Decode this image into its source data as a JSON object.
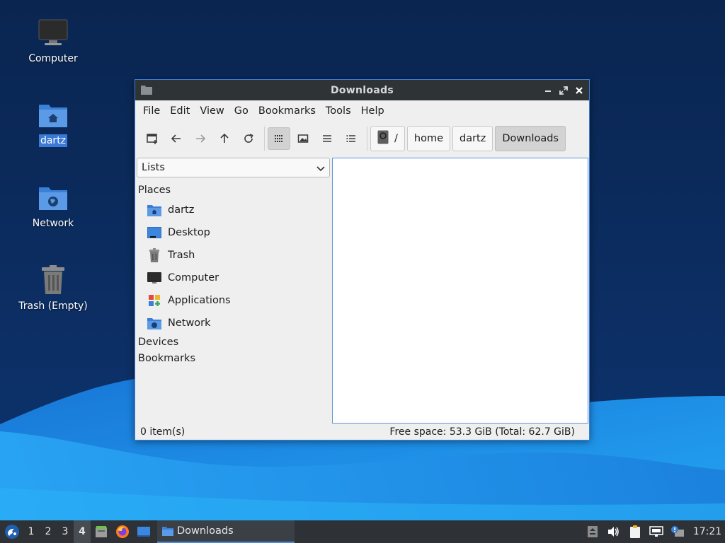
{
  "desktop": {
    "icons": [
      {
        "label": "Computer",
        "icon": "computer-icon"
      },
      {
        "label": "dartz",
        "icon": "home-folder-icon",
        "selected": true
      },
      {
        "label": "Network",
        "icon": "network-folder-icon"
      },
      {
        "label": "Trash (Empty)",
        "icon": "trash-icon"
      }
    ]
  },
  "window": {
    "title": "Downloads",
    "controls": {
      "minimize": "minimize-icon",
      "maximize": "maximize-icon",
      "close": "close-icon"
    },
    "menu": [
      "File",
      "Edit",
      "View",
      "Go",
      "Bookmarks",
      "Tools",
      "Help"
    ],
    "toolbar": {
      "buttons": [
        "new-tab-icon",
        "back-arrow-icon",
        "forward-arrow-icon",
        "up-arrow-icon",
        "reload-icon",
        "icon-view-icon",
        "thumbnail-view-icon",
        "compact-view-icon",
        "detailed-list-view-icon"
      ],
      "active_view": "icon-view-icon"
    },
    "breadcrumbs": [
      "/",
      "home",
      "dartz",
      "Downloads"
    ],
    "sidebar": {
      "mode": "Lists",
      "sections": {
        "places": "Places",
        "devices": "Devices",
        "bookmarks": "Bookmarks"
      },
      "places": [
        {
          "label": "dartz",
          "icon": "home-folder-icon"
        },
        {
          "label": "Desktop",
          "icon": "desktop-icon"
        },
        {
          "label": "Trash",
          "icon": "trash-icon"
        },
        {
          "label": "Computer",
          "icon": "computer-icon"
        },
        {
          "label": "Applications",
          "icon": "applications-icon"
        },
        {
          "label": "Network",
          "icon": "network-folder-icon"
        }
      ]
    },
    "status": {
      "items": "0 item(s)",
      "free_space": "Free space: 53.3 GiB (Total: 62.7 GiB)"
    }
  },
  "taskbar": {
    "workspaces": [
      "1",
      "2",
      "3",
      "4"
    ],
    "active_workspace": "4",
    "task": "Downloads",
    "clock": "17:21"
  },
  "colors": {
    "accent": "#3d7fd9",
    "titlebar": "#2e3336",
    "taskbar": "#2e3136",
    "desktop_dark": "#0b2a55",
    "desktop_wave": "#1f8ae8"
  }
}
